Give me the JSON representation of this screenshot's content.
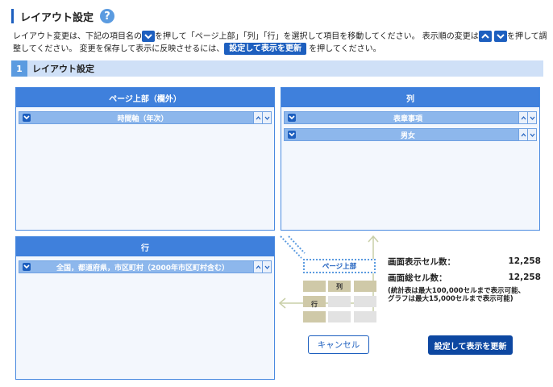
{
  "header": {
    "title": "レイアウト設定",
    "help_icon": "?"
  },
  "description": {
    "part1": "レイアウト変更は、下記の項目名の",
    "part2": "を押して「ページ上部」「列」「行」を選択して項目を移動してください。 表示順の変更は",
    "part3": "を押して調",
    "part4": "整してください。 変更を保存して表示に反映させるには、",
    "inline_button": "設定して表示を更新",
    "part5": "を押してください。"
  },
  "section": {
    "number": "1",
    "label": "レイアウト設定"
  },
  "panels": {
    "page_top": {
      "title": "ページ上部（欄外）",
      "items": [
        {
          "label": "時間軸（年次）"
        }
      ]
    },
    "column": {
      "title": "列",
      "items": [
        {
          "label": "表章事項"
        },
        {
          "label": "男女"
        }
      ]
    },
    "row": {
      "title": "行",
      "items": [
        {
          "label": "全国，都道府県，市区町村（2000年市区町村含む）"
        }
      ]
    }
  },
  "diagram": {
    "page_top_label": "ページ上部",
    "column_label": "列",
    "row_label": "行"
  },
  "stats": {
    "display_cells_label": "画面表示セル数：",
    "display_cells_value": "12,258",
    "total_cells_label": "画面総セル数：",
    "total_cells_value": "12,258",
    "note_line1": "(統計表は最大100,000セルまで表示可能、",
    "note_line2": "グラフは最大15,000セルまで表示可能)"
  },
  "buttons": {
    "cancel": "キャンセル",
    "update": "設定して表示を更新"
  },
  "colors": {
    "accent": "#1d5fbf",
    "panel_header": "#3f80dc",
    "item": "#8db7ec",
    "primary_button": "#0d47a1"
  }
}
